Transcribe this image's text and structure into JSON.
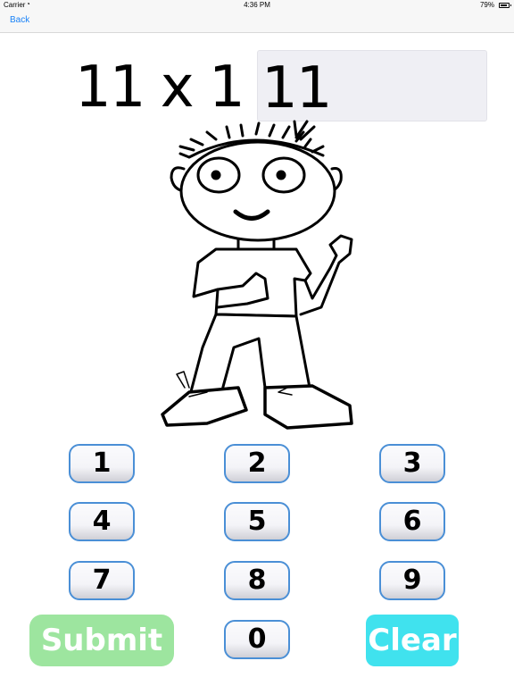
{
  "status_bar": {
    "carrier": "Carrier",
    "wifi_icon": "wifi-icon",
    "time": "4:36 PM",
    "battery": "79%",
    "battery_icon": "battery-icon"
  },
  "nav": {
    "back_label": "Back"
  },
  "problem": {
    "equation": "11 x 1 =",
    "answer": "11"
  },
  "illustration": {
    "description": "cartoon-boy-waving"
  },
  "keypad": {
    "keys": [
      "1",
      "2",
      "3",
      "4",
      "5",
      "6",
      "7",
      "8",
      "9",
      "0"
    ]
  },
  "actions": {
    "submit_label": "Submit",
    "clear_label": "Clear"
  },
  "colors": {
    "submit": "#9de59f",
    "clear": "#40e2ee",
    "key_border": "#4a8fd6",
    "link": "#1a82f7"
  }
}
